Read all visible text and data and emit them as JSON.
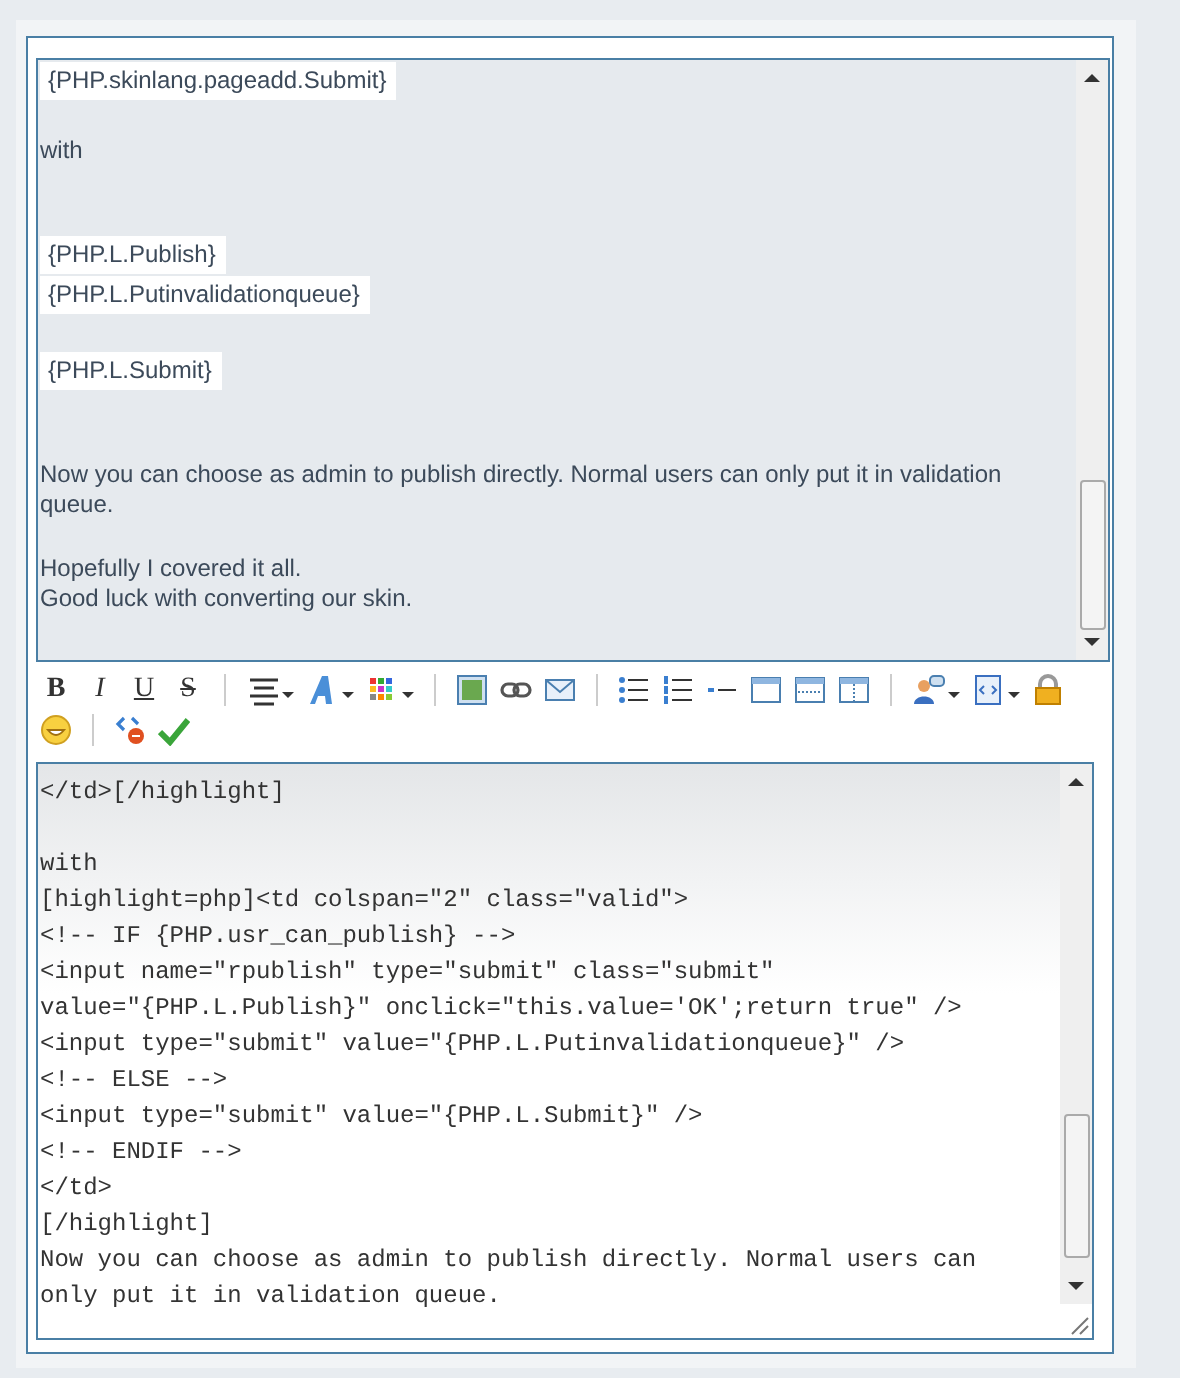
{
  "preview": {
    "items": [
      {
        "kind": "button",
        "text": "{PHP.skinlang.pageadd.Submit}"
      },
      {
        "kind": "break"
      },
      {
        "kind": "text",
        "text": "with"
      },
      {
        "kind": "break"
      },
      {
        "kind": "break"
      },
      {
        "kind": "button",
        "text": "{PHP.L.Publish}"
      },
      {
        "kind": "button",
        "text": "{PHP.L.Putinvalidationqueue}"
      },
      {
        "kind": "break"
      },
      {
        "kind": "button",
        "text": "{PHP.L.Submit}"
      },
      {
        "kind": "break"
      },
      {
        "kind": "break"
      },
      {
        "kind": "text",
        "text": "Now you can choose as admin to publish directly. Normal users can only put it in validation queue."
      },
      {
        "kind": "break"
      },
      {
        "kind": "text",
        "text": "Hopefully I covered it all."
      },
      {
        "kind": "text",
        "text": "Good luck with converting our skin."
      }
    ]
  },
  "toolbar": {
    "format_buttons": [
      "B",
      "I",
      "U",
      "S"
    ]
  },
  "code": {
    "lines": [
      "</td>[/highlight]",
      "with",
      "[highlight=php]<td colspan=\"2\" class=\"valid\">",
      "<!-- IF {PHP.usr_can_publish} -->",
      "<input name=\"rpublish\" type=\"submit\" class=\"submit\"",
      "value=\"{PHP.L.Publish}\" onclick=\"this.value='OK';return true\" />",
      "<input type=\"submit\" value=\"{PHP.L.Putinvalidationqueue}\" />",
      "<!-- ELSE -->",
      "<input type=\"submit\" value=\"{PHP.L.Submit}\" />",
      "<!-- ENDIF -->",
      "</td>",
      "[/highlight]",
      "Now you can choose as admin to publish directly. Normal users can only put it in validation queue."
    ]
  }
}
